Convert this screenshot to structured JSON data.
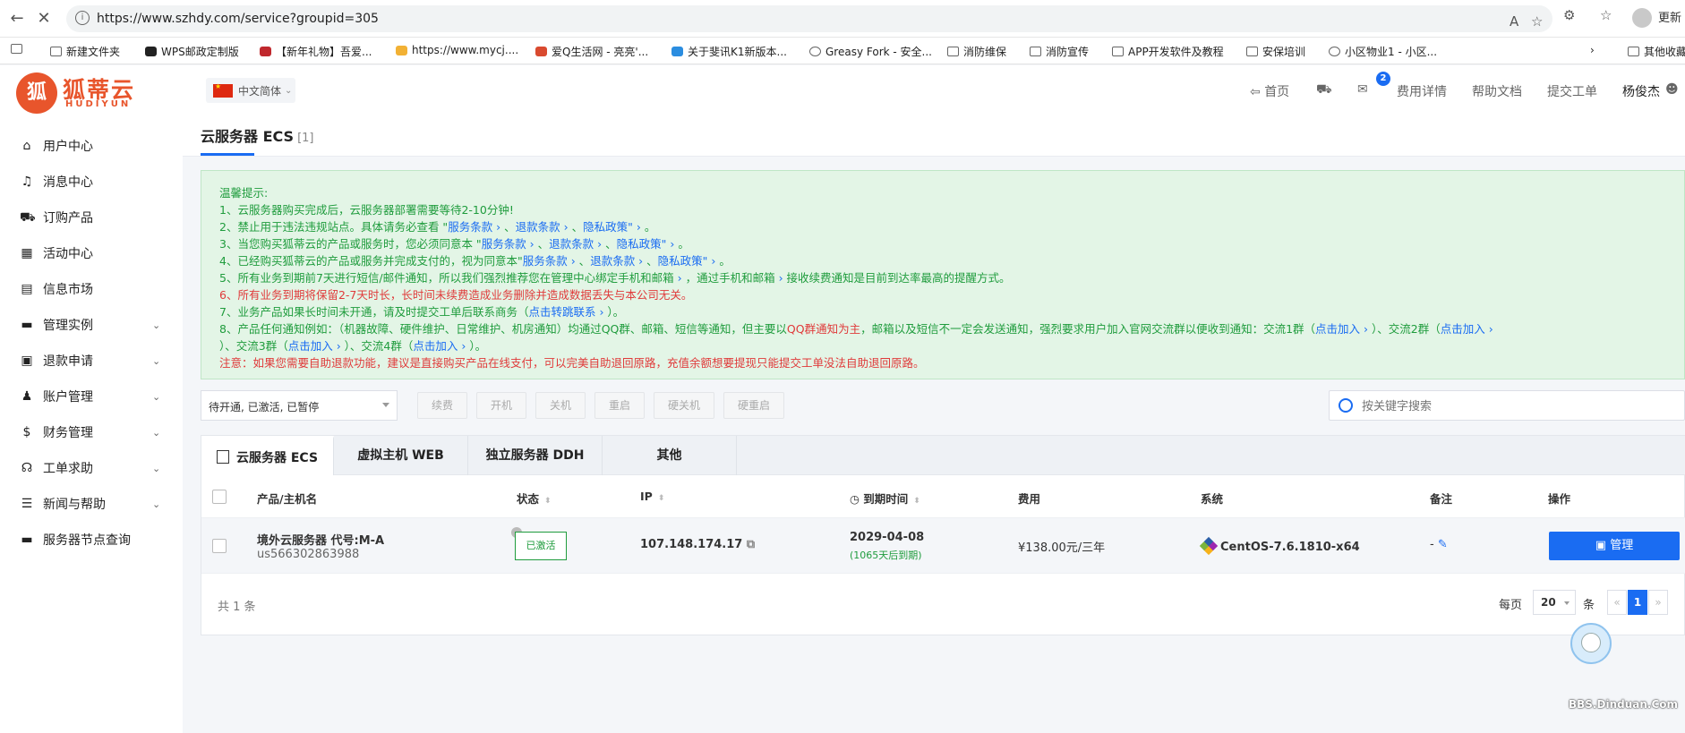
{
  "browser": {
    "url": "https://www.szhdy.com/service?groupid=305",
    "update_label": "更新",
    "bookmarks": [
      {
        "label": "新建文件夹"
      },
      {
        "label": "WPS邮政定制版"
      },
      {
        "label": "【新年礼物】吾爱..."
      },
      {
        "label": "https://www.mycj...."
      },
      {
        "label": "爱Q生活网 - 亮亮'..."
      },
      {
        "label": "关于斐讯K1新版本..."
      },
      {
        "label": "Greasy Fork - 安全..."
      },
      {
        "label": "消防维保"
      },
      {
        "label": "消防宣传"
      },
      {
        "label": "APP开发软件及教程"
      },
      {
        "label": "安保培训"
      },
      {
        "label": "小区物业1 - 小区..."
      },
      {
        "label": "其他收藏"
      }
    ]
  },
  "logo": {
    "cn": "狐蒂云",
    "en": "HUDIYUN"
  },
  "sidebar": {
    "items": [
      {
        "label": "用户中心",
        "icon": "home-icon"
      },
      {
        "label": "消息中心",
        "icon": "bell-icon"
      },
      {
        "label": "订购产品",
        "icon": "cart-icon"
      },
      {
        "label": "活动中心",
        "icon": "grid-icon"
      },
      {
        "label": "信息市场",
        "icon": "store-icon"
      },
      {
        "label": "管理实例",
        "icon": "server-icon"
      },
      {
        "label": "退款申请",
        "icon": "refund-icon"
      },
      {
        "label": "账户管理",
        "icon": "user-icon"
      },
      {
        "label": "财务管理",
        "icon": "money-icon"
      },
      {
        "label": "工单求助",
        "icon": "headset-icon"
      },
      {
        "label": "新闻与帮助",
        "icon": "news-icon"
      },
      {
        "label": "服务器节点查询",
        "icon": "server-node-icon"
      }
    ]
  },
  "topbar": {
    "language": "中文简体",
    "home": "首页",
    "message_count": "2",
    "fees": "费用详情",
    "help_docs": "帮助文档",
    "submit_ticket": "提交工单",
    "username": "杨俊杰"
  },
  "page": {
    "title": "云服务器 ECS",
    "count": "[1]"
  },
  "notice": {
    "heading": "温馨提示:",
    "l1": "1、云服务器购买完成后，云服务器部署需要等待2-10分钟!",
    "l2a": "2、禁止用于违法违规站点。具体请务必查看 \"",
    "l2b": "服务条款 ›",
    "l2c": " 、",
    "l2d": "退款条款 ›",
    "l2e": " 、",
    "l2f": "隐私政策\" ›",
    "l2g": " 。",
    "l3a": "3、当您购买狐蒂云的产品或服务时，您必须同意本 \"",
    "l3b": "服务条款 ›",
    "l3c": " 、",
    "l3d": "退款条款 ›",
    "l3e": " 、",
    "l3f": "隐私政策\" ›",
    "l3g": " 。",
    "l4a": "4、已经购买狐蒂云的产品或服务并完成支付的，视为同意本\"",
    "l4b": "服务条款 ›",
    "l4c": " 、",
    "l4d": "退款条款 ›",
    "l4e": " 、",
    "l4f": "隐私政策\" ›",
    "l4g": " 。",
    "l5a": "5、所有业务到期前7天进行短信/邮件通知，所以我们强烈推荐您在管理中心绑定手机和邮箱",
    "l5b": " ›",
    "l5c": " ，通过手机和邮箱",
    "l5d": " ›",
    "l5e": " 接收续费通知是目前到达率最高的提醒方式。",
    "l6": "6、所有业务到期将保留2-7天时长，长时间未续费造成业务删除并造成数据丢失与本公司无关。",
    "l7a": "7、业务产品如果长时间未开通，请及时提交工单后联系商务（",
    "l7b": "点击转跳联系 ›",
    "l7c": " ）。",
    "l8a": "8、产品任何通知例如：（机器故障、硬件维护、日常维护、机房通知）均通过QQ群、邮箱、短信等通知，但主要以",
    "l8b": "QQ群通知为主",
    "l8c": "，邮箱以及短信不一定会发送通知，强烈要求用户加入官网交流群以便收到通知：交流1群（",
    "l8d": "点击加入 ›",
    "l8e": " ）、交流2群（",
    "l8f": "点击加入 ›",
    "l9a": " ）、交流3群（",
    "l9b": "点击加入 ›",
    "l9c": " ）、交流4群（",
    "l9d": "点击加入 ›",
    "l9e": " ）。",
    "l10": "注意：如果您需要自助退款功能，建议是直接购买产品在线支付，可以完美自助退回原路，充值余额想要提现只能提交工单没法自助退回原路。"
  },
  "toolbar": {
    "status_filter": "待开通, 已激活, 已暂停",
    "actions": [
      "续费",
      "开机",
      "关机",
      "重启",
      "硬关机",
      "硬重启"
    ],
    "search_placeholder": "按关键字搜索"
  },
  "tabs": [
    {
      "label": "云服务器 ECS"
    },
    {
      "label": "虚拟主机 WEB"
    },
    {
      "label": "独立服务器 DDH"
    },
    {
      "label": "其他"
    }
  ],
  "table": {
    "headers": {
      "product": "产品/主机名",
      "status": "状态",
      "ip": "IP",
      "expire": "到期时间",
      "fee": "费用",
      "os": "系统",
      "note": "备注",
      "action": "操作"
    },
    "rows": [
      {
        "product": "境外云服务器 代号:M-A",
        "hostname": "us566302863988",
        "status": "已激活",
        "ip": "107.148.174.17",
        "expire_date": "2029-04-08",
        "expire_note": "(1065天后到期)",
        "fee": "¥138.00元/三年",
        "os": "CentOS-7.6.1810-x64",
        "note": "-",
        "action": "管理"
      }
    ]
  },
  "pager": {
    "total": "共 1 条",
    "per_page_label": "每页",
    "per_page": "20",
    "unit": "条",
    "prev": "«",
    "current": "1",
    "next": "»"
  },
  "watermark": "BBS.Dinduan.Com",
  "colors": {
    "accent": "#1a6cf2",
    "brand": "#e8552c",
    "success": "#1f9c3d",
    "danger": "#e03a3a"
  }
}
